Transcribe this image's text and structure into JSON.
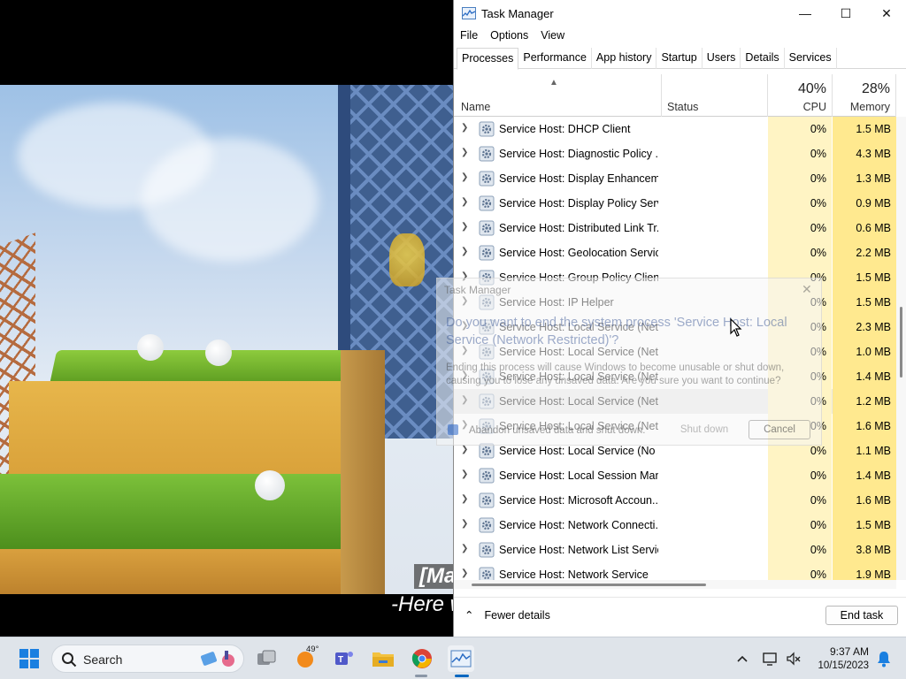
{
  "video": {
    "subtitle_line1": "[Ma",
    "subtitle_line2": "-Here w"
  },
  "task_manager": {
    "title": "Task Manager",
    "controls": {
      "minimize": "—",
      "maximize": "☐",
      "close": "✕"
    },
    "menu": [
      "File",
      "Options",
      "View"
    ],
    "tabs": [
      "Processes",
      "Performance",
      "App history",
      "Startup",
      "Users",
      "Details",
      "Services"
    ],
    "active_tab": "Processes",
    "columns": {
      "name": "Name",
      "status": "Status",
      "cpu_label": "CPU",
      "cpu_total": "40%",
      "memory_label": "Memory",
      "memory_total": "28%"
    },
    "rows": [
      {
        "name": "Service Host: DHCP Client",
        "cpu": "0%",
        "memory": "1.5 MB"
      },
      {
        "name": "Service Host: Diagnostic Policy ...",
        "cpu": "0%",
        "memory": "4.3 MB"
      },
      {
        "name": "Service Host: Display Enhancem...",
        "cpu": "0%",
        "memory": "1.3 MB"
      },
      {
        "name": "Service Host: Display Policy Serv...",
        "cpu": "0%",
        "memory": "0.9 MB"
      },
      {
        "name": "Service Host: Distributed Link Tr...",
        "cpu": "0%",
        "memory": "0.6 MB"
      },
      {
        "name": "Service Host: Geolocation Service",
        "cpu": "0%",
        "memory": "2.2 MB"
      },
      {
        "name": "Service Host: Group Policy Client",
        "cpu": "0%",
        "memory": "1.5 MB"
      },
      {
        "name": "Service Host: IP Helper",
        "cpu": "0%",
        "memory": "1.5 MB"
      },
      {
        "name": "Service Host: Local Service (Net...",
        "cpu": "0%",
        "memory": "2.3 MB"
      },
      {
        "name": "Service Host: Local Service (Net...",
        "cpu": "0%",
        "memory": "1.0 MB"
      },
      {
        "name": "Service Host: Local Service (Net...",
        "cpu": "0%",
        "memory": "1.4 MB"
      },
      {
        "name": "Service Host: Local Service (Net...",
        "cpu": "0%",
        "memory": "1.2 MB",
        "highlight": true
      },
      {
        "name": "Service Host: Local Service (Net...",
        "cpu": "0%",
        "memory": "1.6 MB"
      },
      {
        "name": "Service Host: Local Service (No ...",
        "cpu": "0%",
        "memory": "1.1 MB"
      },
      {
        "name": "Service Host: Local Session Man...",
        "cpu": "0%",
        "memory": "1.4 MB"
      },
      {
        "name": "Service Host: Microsoft Accoun...",
        "cpu": "0%",
        "memory": "1.6 MB"
      },
      {
        "name": "Service Host: Network Connecti...",
        "cpu": "0%",
        "memory": "1.5 MB"
      },
      {
        "name": "Service Host: Network List Service",
        "cpu": "0%",
        "memory": "3.8 MB"
      },
      {
        "name": "Service Host: Network Service",
        "cpu": "0%",
        "memory": "1.9 MB"
      }
    ],
    "footer": {
      "fewer_details": "Fewer details",
      "end_task": "End task"
    }
  },
  "dialog": {
    "title": "Task Manager",
    "heading": "Do you want to end the system process 'Service Host: Local Service (Network Restricted)'?",
    "body": "Ending this process will cause Windows to become unusable or shut down, causing you to lose any unsaved data. Are you sure you want to continue?",
    "checkbox_label": "Abandon unsaved data and shut down.",
    "shutdown_label": "Shut down",
    "cancel_label": "Cancel"
  },
  "taskbar": {
    "search_label": "Search",
    "weather_temp": "49°",
    "time": "9:37 AM",
    "date": "10/15/2023",
    "apps": [
      "start-icon",
      "task-view-icon",
      "weather-icon",
      "teams-icon",
      "file-explorer-icon",
      "chrome-icon",
      "task-manager-icon"
    ]
  },
  "colors": {
    "cpu_column": "#fff4c4",
    "memory_column": "#ffe98f",
    "taskbar": "#dfe4ea",
    "accent": "#0067c0"
  }
}
